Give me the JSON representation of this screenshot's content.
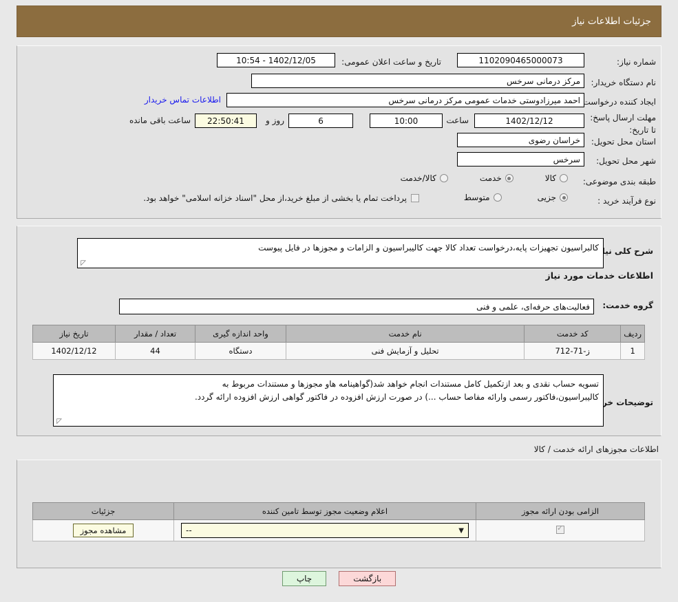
{
  "header": {
    "title": "جزئیات اطلاعات نیاز"
  },
  "fields": {
    "need_number_label": "شماره نیاز:",
    "need_number_value": "1102090465000073",
    "announce_label": "تاریخ و ساعت اعلان عمومی:",
    "announce_value": "1402/12/05 - 10:54",
    "buyer_org_label": "نام دستگاه خریدار:",
    "buyer_org_value": "مرکز درمانی سرخس",
    "requester_label": "ایجاد کننده درخواست:",
    "requester_value": "احمد میرزادوستی خدمات  عمومی مرکز درمانی سرخس",
    "contact_link": "اطلاعات تماس خریدار",
    "deadline_label": "مهلت ارسال پاسخ: تا تاریخ:",
    "deadline_date": "1402/12/12",
    "hour_label": "ساعت",
    "hour_value": "10:00",
    "days_value": "6",
    "days_label": "روز و",
    "countdown_value": "22:50:41",
    "remaining_label": "ساعت باقی مانده",
    "province_label": "استان محل تحویل:",
    "province_value": "خراسان رضوی",
    "city_label": "شهر محل تحویل:",
    "city_value": "سرخس",
    "category_label": "طبقه بندی موضوعی:",
    "purchase_type_label": "نوع فرآیند خرید :",
    "treasury_note": "پرداخت تمام یا بخشی از مبلغ خرید،از محل \"اسناد خزانه اسلامی\" خواهد بود."
  },
  "category_options": [
    {
      "label": "کالا",
      "selected": false
    },
    {
      "label": "خدمت",
      "selected": true
    },
    {
      "label": "کالا/خدمت",
      "selected": false
    }
  ],
  "purchase_options": [
    {
      "label": "جزیی",
      "selected": true
    },
    {
      "label": "متوسط",
      "selected": false
    }
  ],
  "treasury_checked": false,
  "summary": {
    "label": "شرح کلی نیاز:",
    "text": "کالبراسیون تجهیزات پایه،درخواست تعداد کالا جهت کالیبراسیون و الزامات و مجوزها در فایل پیوست"
  },
  "services_section": {
    "heading": "اطلاعات خدمات مورد نیاز",
    "group_label": "گروه خدمت:",
    "group_value": "فعالیت‌های حرفه‌ای، علمی و فنی",
    "columns": [
      "ردیف",
      "کد خدمت",
      "نام خدمت",
      "واحد اندازه گیری",
      "تعداد / مقدار",
      "تاریخ نیاز"
    ],
    "rows": [
      {
        "radif": "1",
        "code": "ز-71-712",
        "name": "تحلیل و آزمایش فنی",
        "unit": "دستگاه",
        "qty": "44",
        "date": "1402/12/12"
      }
    ]
  },
  "buyer_notes": {
    "label": "توضیحات خریدار:",
    "line1": "تسویه حساب نقدی و بعد ازتکمیل  کامل مستندات انجام خواهد شد(گواهینامه هاو مجوزها و مستندات مربوط به",
    "line2": "کالیبراسیون،فاکتور رسمی وارائه مفاصا حساب ...) در صورت ارزش افزوده در فاکتور گواهی ارزش افزوده ارائه گردد."
  },
  "permits_section": {
    "heading": "اطلاعات مجوزهای ارائه خدمت / کالا",
    "columns": [
      "الزامی بودن ارائه مجوز",
      "اعلام وضعیت مجوز توسط تامین کننده",
      "جزئیات"
    ],
    "rows": [
      {
        "required_checked": true,
        "status_value": "--",
        "details_button": "مشاهده مجوز"
      }
    ]
  },
  "buttons": {
    "print": "چاپ",
    "back": "بازگشت"
  },
  "colors": {
    "header_bar": "#8c6d3f",
    "page_bg": "#e8e8e8",
    "panel_bg": "#e3e3e3",
    "link": "#1a1aee",
    "table_header": "#bdbdbd",
    "yellow_field": "#fbfbe1",
    "print_btn": "#ddf5dd",
    "back_btn": "#fcd8d8"
  }
}
